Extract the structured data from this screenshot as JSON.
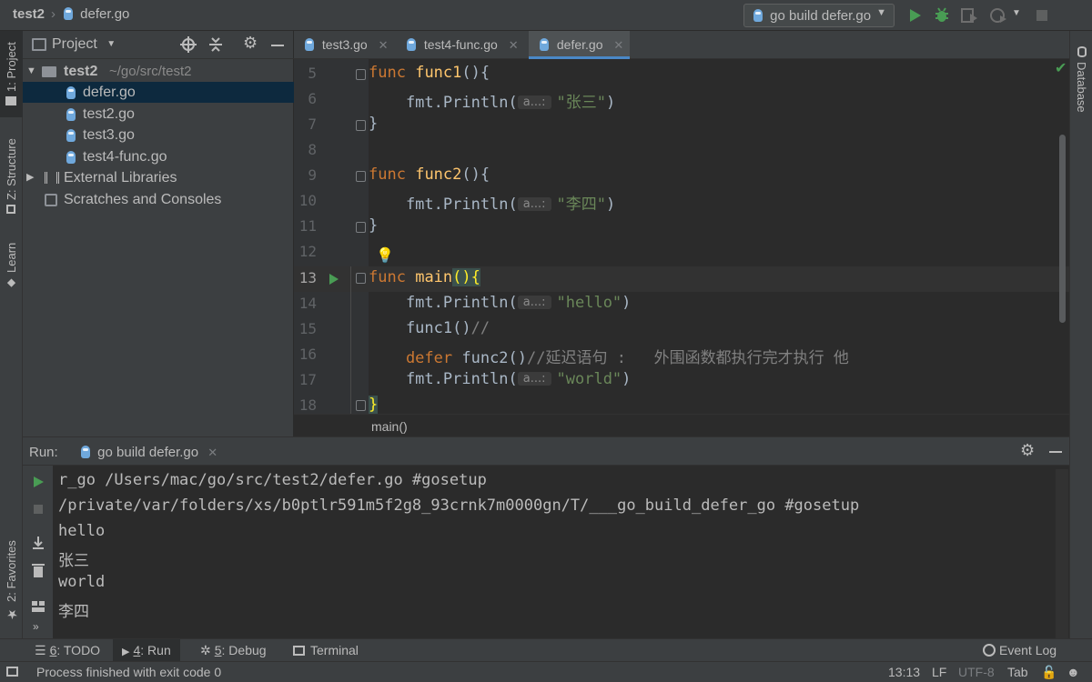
{
  "navbar": {
    "breadcrumb": [
      "test2",
      "defer.go"
    ],
    "run_config": "go build defer.go"
  },
  "left_strip": {
    "tabs": [
      "1: Project",
      "Z: Structure",
      "Learn",
      "2: Favorites"
    ]
  },
  "right_strip": {
    "tabs": [
      "Database"
    ]
  },
  "project": {
    "title": "Project",
    "root": {
      "name": "test2",
      "path": "~/go/src/test2"
    },
    "files": [
      "defer.go",
      "test2.go",
      "test3.go",
      "test4-func.go"
    ],
    "external": "External Libraries",
    "scratches": "Scratches and Consoles"
  },
  "editor": {
    "tabs": [
      "test3.go",
      "test4-func.go",
      "defer.go"
    ],
    "active_tab": "defer.go",
    "current_line": 13,
    "line_numbers": [
      "5",
      "6",
      "7",
      "8",
      "9",
      "10",
      "11",
      "12",
      "13",
      "14",
      "15",
      "16",
      "17",
      "18"
    ],
    "hint": "a...:",
    "lines": {
      "l5": {
        "kw": "func",
        "fn": "func1",
        "rest": "(){"
      },
      "l6": {
        "pre": "    fmt.Println(",
        "str": "\"张三\"",
        "post": ")"
      },
      "l7": "}",
      "l9": {
        "kw": "func",
        "fn": "func2",
        "rest": "(){"
      },
      "l10": {
        "pre": "    fmt.Println(",
        "str": "\"李四\"",
        "post": ")"
      },
      "l11": "}",
      "l13": {
        "kw": "func",
        "fn": "main",
        "paren": "()",
        "brace": "{"
      },
      "l14": {
        "pre": "    fmt.Println(",
        "str": "\"hello\"",
        "post": ")"
      },
      "l15": {
        "pre": "    func1()",
        "cm": "//"
      },
      "l16": {
        "kw": "    defer",
        "pre": " func2()",
        "cm": "//延迟语句 :   外围函数都执行完才执行 他"
      },
      "l17": {
        "pre": "    fmt.Println(",
        "str": "\"world\"",
        "post": ")"
      },
      "l18": "}"
    },
    "breadcrumb": "main()"
  },
  "run": {
    "label": "Run:",
    "tab": "go build defer.go",
    "output": [
      "r_go /Users/mac/go/src/test2/defer.go #gosetup",
      "/private/var/folders/xs/b0ptlr591m5f2g8_93crnk7m0000gn/T/___go_build_defer_go #gosetup",
      "hello",
      "张三",
      "world",
      "李四"
    ]
  },
  "bottom_tabs": [
    {
      "key": "6",
      "label": ": TODO"
    },
    {
      "key": "4",
      "label": ": Run"
    },
    {
      "key": "5",
      "label": ": Debug"
    },
    {
      "key": "",
      "label": "Terminal"
    }
  ],
  "event_log": "Event Log",
  "status": {
    "message": "Process finished with exit code 0",
    "position": "13:13",
    "line_sep": "LF",
    "encoding": "UTF-8",
    "indent": "Tab"
  },
  "colors": {
    "keyword": "#cc7832",
    "function": "#ffc66d",
    "string": "#6a8759",
    "comment": "#808080",
    "run_green": "#499c54",
    "selection": "#0d293e",
    "accent": "#4a88c7"
  }
}
